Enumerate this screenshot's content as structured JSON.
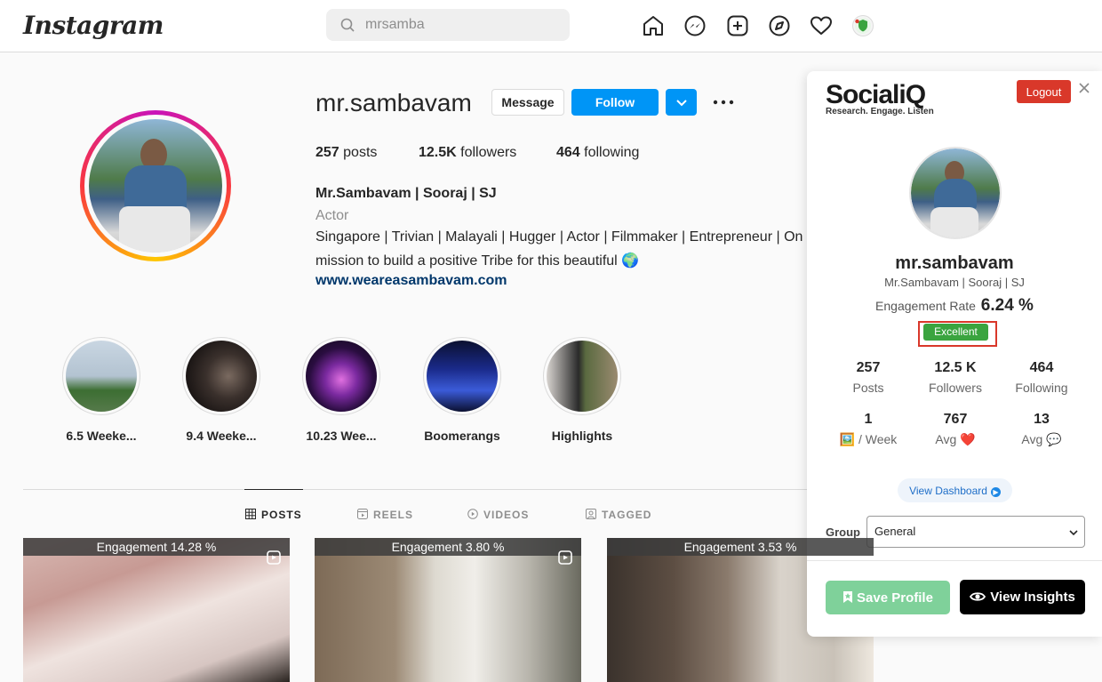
{
  "nav": {
    "logo": "Instagram",
    "search_value": "mrsamba",
    "icons": [
      "home-icon",
      "messenger-icon",
      "new-post-icon",
      "explore-icon",
      "heart-icon",
      "profile-avatar"
    ]
  },
  "profile": {
    "username": "mr.sambavam",
    "message_label": "Message",
    "follow_label": "Follow",
    "stats": {
      "posts_count": "257",
      "posts_label": "posts",
      "followers_count": "12.5K",
      "followers_label": "followers",
      "following_count": "464",
      "following_label": "following"
    },
    "full_name": "Mr.Sambavam | Sooraj | SJ",
    "category": "Actor",
    "bio_line1": "Singapore | Trivian | Malayali | Hugger | Actor | Filmmaker | Entrepreneur | On",
    "bio_line2": "mission to build a positive Tribe for this beautiful 🌍",
    "link": "www.weareasambavam.com"
  },
  "highlights": [
    {
      "label": "6.5 Weeke..."
    },
    {
      "label": "9.4 Weeke..."
    },
    {
      "label": "10.23 Wee..."
    },
    {
      "label": "Boomerangs"
    },
    {
      "label": "Highlights"
    }
  ],
  "tabs": [
    {
      "label": "POSTS",
      "icon": "grid-icon",
      "active": true
    },
    {
      "label": "REELS",
      "icon": "reels-icon",
      "active": false
    },
    {
      "label": "VIDEOS",
      "icon": "video-icon",
      "active": false
    },
    {
      "label": "TAGGED",
      "icon": "tagged-icon",
      "active": false
    }
  ],
  "posts": [
    {
      "engagement": "Engagement 14.28 %"
    },
    {
      "engagement": "Engagement 3.80 %"
    },
    {
      "engagement": "Engagement 3.53 %"
    }
  ],
  "socialiq": {
    "brand": "SocialiQ",
    "tagline": "Research. Engage. Listen",
    "logout_label": "Logout",
    "username": "mr.sambavam",
    "full_name": "Mr.Sambavam | Sooraj | SJ",
    "engagement_label": "Engagement Rate",
    "engagement_value": "6.24 %",
    "rating": "Excellent",
    "metrics": [
      {
        "value": "257",
        "label": "Posts"
      },
      {
        "value": "12.5 K",
        "label": "Followers"
      },
      {
        "value": "464",
        "label": "Following"
      },
      {
        "value": "1",
        "label": "🖼️ / Week"
      },
      {
        "value": "767",
        "label": "Avg ❤️"
      },
      {
        "value": "13",
        "label": "Avg 💬"
      }
    ],
    "dashboard_label": "View Dashboard",
    "group_label": "Group",
    "group_value": "General",
    "save_label": "Save Profile",
    "insights_label": "View Insights"
  },
  "colors": {
    "accent_blue": "#0095f6",
    "logout_red": "#d9382a",
    "excellent_green": "#3aa43f",
    "save_green": "#7fd19a"
  }
}
